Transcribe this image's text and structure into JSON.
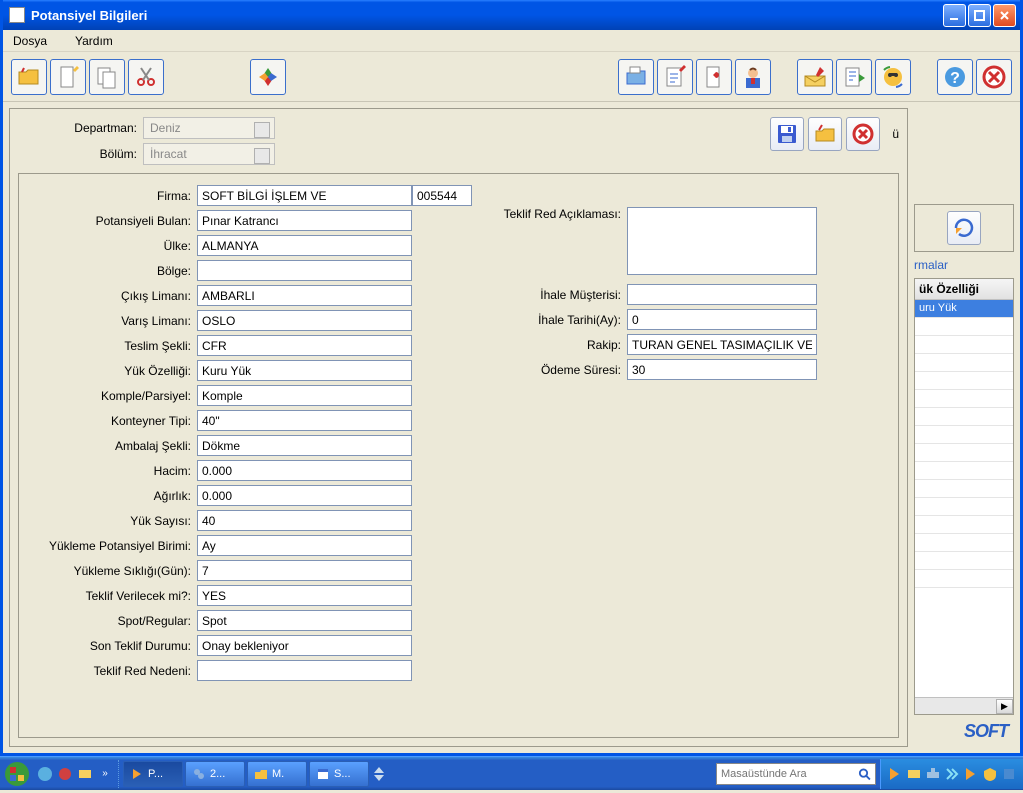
{
  "window": {
    "title": "Potansiyel Bilgileri",
    "menus": [
      "Dosya",
      "Yardım"
    ]
  },
  "toolbar": {
    "icons": [
      "open",
      "edit",
      "copy",
      "cut",
      "plugin",
      "docs",
      "note",
      "pin",
      "person",
      "mail",
      "send",
      "refresh",
      "help",
      "close"
    ]
  },
  "save_bar": {
    "u_label": "ü"
  },
  "combos": {
    "departman_label": "Departman:",
    "departman_value": "Deniz",
    "bolum_label": "Bölüm:",
    "bolum_value": "İhracat"
  },
  "form": {
    "firma_label": "Firma:",
    "firma_value": "SOFT BİLGİ İŞLEM VE",
    "firma_code": "005544",
    "potansiyeli_bulan_label": "Potansiyeli Bulan:",
    "potansiyeli_bulan_value": "Pınar Katrancı",
    "ulke_label": "Ülke:",
    "ulke_value": "ALMANYA",
    "bolge_label": "Bölge:",
    "bolge_value": "",
    "cikis_limani_label": "Çıkış Limanı:",
    "cikis_limani_value": "AMBARLI",
    "varis_limani_label": "Varış Limanı:",
    "varis_limani_value": "OSLO",
    "teslim_sekli_label": "Teslim Şekli:",
    "teslim_sekli_value": "CFR",
    "yuk_ozelligi_label": "Yük Özelliği:",
    "yuk_ozelligi_value": "Kuru Yük",
    "komple_parsiyel_label": "Komple/Parsiyel:",
    "komple_parsiyel_value": "Komple",
    "konteyner_tipi_label": "Konteyner Tipi:",
    "konteyner_tipi_value": "40\"",
    "ambalaj_sekli_label": "Ambalaj Şekli:",
    "ambalaj_sekli_value": "Dökme",
    "hacim_label": "Hacim:",
    "hacim_value": "0.000",
    "agirlik_label": "Ağırlık:",
    "agirlik_value": "0.000",
    "yuk_sayisi_label": "Yük Sayısı:",
    "yuk_sayisi_value": "40",
    "yukleme_birimi_label": "Yükleme Potansiyel Birimi:",
    "yukleme_birimi_value": "Ay",
    "yukleme_sikligi_label": "Yükleme Sıklığı(Gün):",
    "yukleme_sikligi_value": "7",
    "teklif_verilecek_label": "Teklif Verilecek mi?:",
    "teklif_verilecek_value": "YES",
    "spot_regular_label": "Spot/Regular:",
    "spot_regular_value": "Spot",
    "son_teklif_durumu_label": "Son Teklif Durumu:",
    "son_teklif_durumu_value": "Onay bekleniyor",
    "teklif_red_nedeni_label": "Teklif Red Nedeni:",
    "teklif_red_nedeni_value": ""
  },
  "form2": {
    "teklif_red_aciklamasi_label": "Teklif Red Açıklaması:",
    "ihale_musterisi_label": "İhale Müşterisi:",
    "ihale_musterisi_value": "",
    "ihale_tarihi_label": "İhale Tarihi(Ay):",
    "ihale_tarihi_value": "0",
    "rakip_label": "Rakip:",
    "rakip_value": "TURAN GENEL TASIMAÇILIK VE",
    "odeme_suresi_label": "Ödeme Süresi:",
    "odeme_suresi_value": "30"
  },
  "side": {
    "link": "rmalar",
    "header": "ük Özelliği",
    "row_selected": "uru Yük"
  },
  "logo": "SOFT",
  "taskbar": {
    "items": [
      "P...",
      "2...",
      "M.",
      "S..."
    ],
    "search_placeholder": "Masaüstünde Ara"
  }
}
